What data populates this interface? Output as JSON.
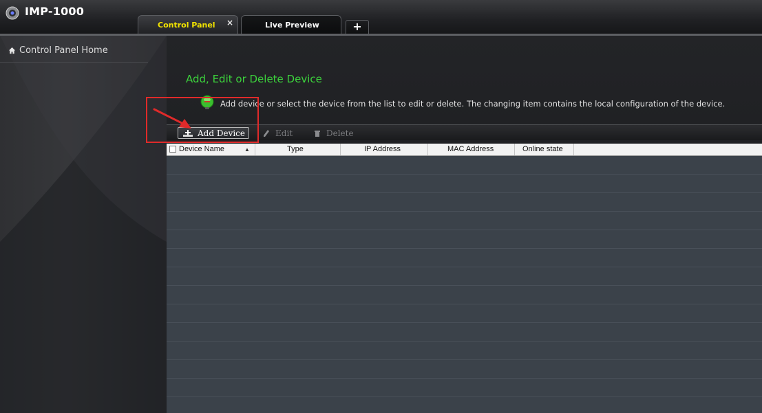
{
  "app": {
    "title": "IMP-1000"
  },
  "tabs": [
    {
      "label": "Control Panel",
      "active": true
    },
    {
      "label": "Live Preview",
      "active": false
    }
  ],
  "tab_close_glyph": "×",
  "tab_add_glyph": "+",
  "sidebar": {
    "home_label": "Control Panel Home"
  },
  "main": {
    "title": "Add, Edit or Delete Device",
    "info_text": "Add device or select the device from the list to edit or delete. The changing item contains the local configuration of the device."
  },
  "toolbar": {
    "add_label": "Add Device",
    "edit_label": "Edit",
    "delete_label": "Delete"
  },
  "table": {
    "columns": [
      "Device Name",
      "Type",
      "IP Address",
      "MAC Address",
      "Online state"
    ],
    "rows": []
  },
  "colors": {
    "title_green": "#3cd23c",
    "active_tab_text": "#f2e300",
    "annotation_red": "#e02a2a"
  },
  "icons": {
    "app_logo": "camera-icon",
    "home": "home-icon",
    "info": "info-bulb-icon",
    "add": "add-device-icon",
    "edit": "pencil-icon",
    "delete": "trash-icon"
  }
}
